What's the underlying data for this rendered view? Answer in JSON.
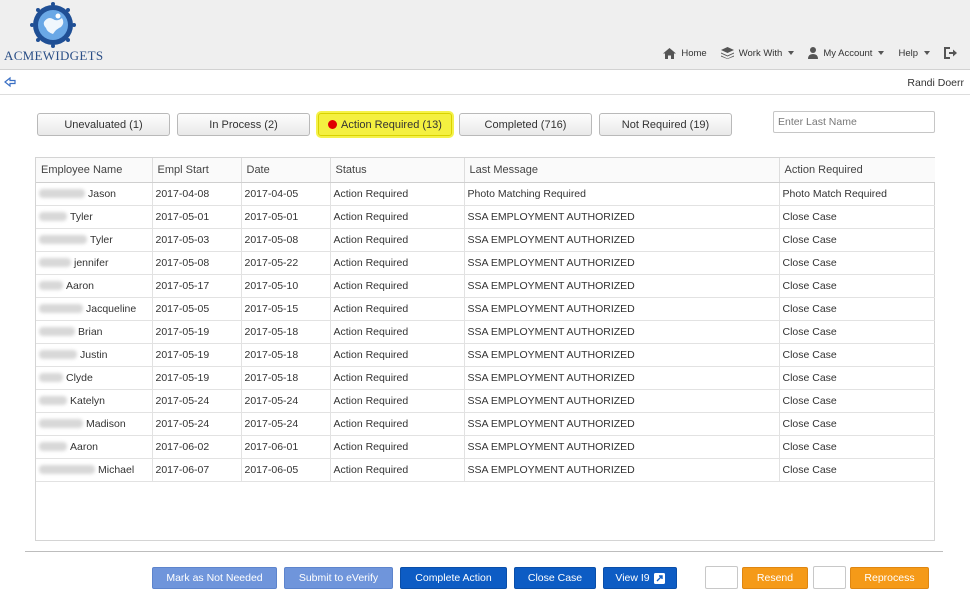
{
  "brand": {
    "name": "ACMEWIDGETS"
  },
  "nav": {
    "home": "Home",
    "work_with": "Work With",
    "my_account": "My Account",
    "help": "Help"
  },
  "user": {
    "name": "Randi Doerr"
  },
  "tabs": [
    {
      "label": "Unevaluated (1)",
      "active": false
    },
    {
      "label": "In Process (2)",
      "active": false
    },
    {
      "label": "Action Required (13)",
      "active": true
    },
    {
      "label": "Completed (716)",
      "active": false
    },
    {
      "label": "Not Required (19)",
      "active": false
    }
  ],
  "search": {
    "placeholder": "Enter Last Name",
    "value": ""
  },
  "table": {
    "columns": [
      "Employee Name",
      "Empl Start",
      "Date",
      "Status",
      "Last Message",
      "Action Required"
    ],
    "rows": [
      {
        "name": "Jason",
        "empl_start": "2017-04-08",
        "date": "2017-04-05",
        "status": "Action Required",
        "last_message": "Photo Matching Required",
        "action": "Photo Match Required"
      },
      {
        "name": "Tyler",
        "empl_start": "2017-05-01",
        "date": "2017-05-01",
        "status": "Action Required",
        "last_message": "SSA EMPLOYMENT AUTHORIZED",
        "action": "Close Case"
      },
      {
        "name": "Tyler",
        "empl_start": "2017-05-03",
        "date": "2017-05-08",
        "status": "Action Required",
        "last_message": "SSA EMPLOYMENT AUTHORIZED",
        "action": "Close Case"
      },
      {
        "name": "jennifer",
        "empl_start": "2017-05-08",
        "date": "2017-05-22",
        "status": "Action Required",
        "last_message": "SSA EMPLOYMENT AUTHORIZED",
        "action": "Close Case"
      },
      {
        "name": "Aaron",
        "empl_start": "2017-05-17",
        "date": "2017-05-10",
        "status": "Action Required",
        "last_message": "SSA EMPLOYMENT AUTHORIZED",
        "action": "Close Case"
      },
      {
        "name": "Jacqueline",
        "empl_start": "2017-05-05",
        "date": "2017-05-15",
        "status": "Action Required",
        "last_message": "SSA EMPLOYMENT AUTHORIZED",
        "action": "Close Case"
      },
      {
        "name": "Brian",
        "empl_start": "2017-05-19",
        "date": "2017-05-18",
        "status": "Action Required",
        "last_message": "SSA EMPLOYMENT AUTHORIZED",
        "action": "Close Case"
      },
      {
        "name": "Justin",
        "empl_start": "2017-05-19",
        "date": "2017-05-18",
        "status": "Action Required",
        "last_message": "SSA EMPLOYMENT AUTHORIZED",
        "action": "Close Case"
      },
      {
        "name": "Clyde",
        "empl_start": "2017-05-19",
        "date": "2017-05-18",
        "status": "Action Required",
        "last_message": "SSA EMPLOYMENT AUTHORIZED",
        "action": "Close Case"
      },
      {
        "name": "Katelyn",
        "empl_start": "2017-05-24",
        "date": "2017-05-24",
        "status": "Action Required",
        "last_message": "SSA EMPLOYMENT AUTHORIZED",
        "action": "Close Case"
      },
      {
        "name": "Madison",
        "empl_start": "2017-05-24",
        "date": "2017-05-24",
        "status": "Action Required",
        "last_message": "SSA EMPLOYMENT AUTHORIZED",
        "action": "Close Case"
      },
      {
        "name": "Aaron",
        "empl_start": "2017-06-02",
        "date": "2017-06-01",
        "status": "Action Required",
        "last_message": "SSA EMPLOYMENT AUTHORIZED",
        "action": "Close Case"
      },
      {
        "name": "Michael",
        "empl_start": "2017-06-07",
        "date": "2017-06-05",
        "status": "Action Required",
        "last_message": "SSA EMPLOYMENT AUTHORIZED",
        "action": "Close Case"
      }
    ]
  },
  "actions": {
    "mark_not_needed": "Mark as Not Needed",
    "submit_everify": "Submit to eVerify",
    "complete_action": "Complete Action",
    "close_case": "Close Case",
    "view_i9": "View I9",
    "resend": "Resend",
    "reprocess": "Reprocess"
  },
  "colors": {
    "brand_blue": "#2a4e86",
    "active_tab": "#f4f040",
    "alert_dot": "#e00000",
    "button_light_blue": "#6f95db",
    "button_dark_blue": "#0d5cc4",
    "button_orange": "#f59a18"
  },
  "icons": {
    "logo": "globe-logo-icon",
    "home": "home-icon",
    "work_with": "stack-icon",
    "my_account": "person-icon",
    "logout": "logout-icon",
    "back": "back-arrow-icon",
    "alert": "red-dot-icon",
    "view_i9": "external-link-icon"
  }
}
